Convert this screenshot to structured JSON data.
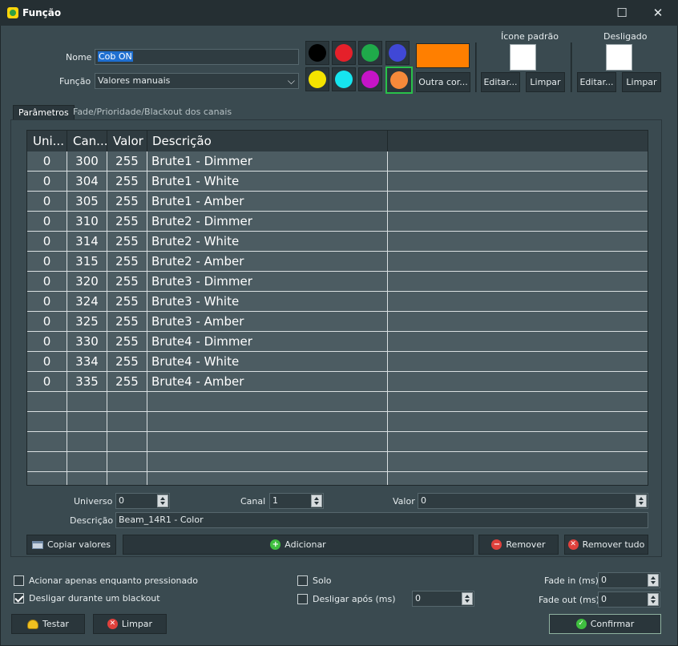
{
  "window": {
    "title": "Função"
  },
  "form": {
    "nome_label": "Nome",
    "nome_value": "Cob ON",
    "funcao_label": "Função",
    "funcao_value": "Valores manuais"
  },
  "colors": {
    "swatches": [
      "#000000",
      "#e5202a",
      "#1faa4a",
      "#4048d6",
      "#f5e400",
      "#16e5ef",
      "#c514c7",
      "#f5893a"
    ],
    "selected": "#f5893a",
    "preview": "#ff7f00",
    "other_label": "Outra cor..."
  },
  "icons": {
    "default_title": "Ícone padrão",
    "off_title": "Desligado",
    "edit_label": "Editar...",
    "clear_label": "Limpar"
  },
  "tabs": [
    {
      "label": "Parâmetros"
    },
    {
      "label": "Fade/Prioridade/Blackout dos canais"
    }
  ],
  "table": {
    "headers": [
      "Uni...",
      "Can...",
      "Valor",
      "Descrição",
      ""
    ],
    "rows": [
      [
        "0",
        "300",
        "255",
        "Brute1 - Dimmer"
      ],
      [
        "0",
        "304",
        "255",
        "Brute1 - White"
      ],
      [
        "0",
        "305",
        "255",
        "Brute1 - Amber"
      ],
      [
        "0",
        "310",
        "255",
        "Brute2 - Dimmer"
      ],
      [
        "0",
        "314",
        "255",
        "Brute2 - White"
      ],
      [
        "0",
        "315",
        "255",
        "Brute2 - Amber"
      ],
      [
        "0",
        "320",
        "255",
        "Brute3 - Dimmer"
      ],
      [
        "0",
        "324",
        "255",
        "Brute3 - White"
      ],
      [
        "0",
        "325",
        "255",
        "Brute3 - Amber"
      ],
      [
        "0",
        "330",
        "255",
        "Brute4 - Dimmer"
      ],
      [
        "0",
        "334",
        "255",
        "Brute4 - White"
      ],
      [
        "0",
        "335",
        "255",
        "Brute4 - Amber"
      ]
    ]
  },
  "editor": {
    "universo_label": "Universo",
    "universo_value": "0",
    "canal_label": "Canal",
    "canal_value": "1",
    "valor_label": "Valor",
    "valor_value": "0",
    "descricao_label": "Descrição",
    "descricao_value": "Beam_14R1 - Color"
  },
  "actions": {
    "copy_label": "Copiar valores",
    "add_label": "Adicionar",
    "remove_label": "Remover",
    "remove_all_label": "Remover tudo"
  },
  "options": {
    "press_only_label": "Acionar apenas enquanto pressionado",
    "press_only_checked": false,
    "blackout_label": "Desligar durante um blackout",
    "blackout_checked": true,
    "solo_label": "Solo",
    "solo_checked": false,
    "off_after_label": "Desligar após (ms)",
    "off_after_checked": false,
    "off_after_value": "0",
    "fade_in_label": "Fade in (ms)",
    "fade_in_value": "0",
    "fade_out_label": "Fade out (ms)",
    "fade_out_value": "0"
  },
  "footer": {
    "test_label": "Testar",
    "clear_label": "Limpar",
    "confirm_label": "Confirmar"
  }
}
